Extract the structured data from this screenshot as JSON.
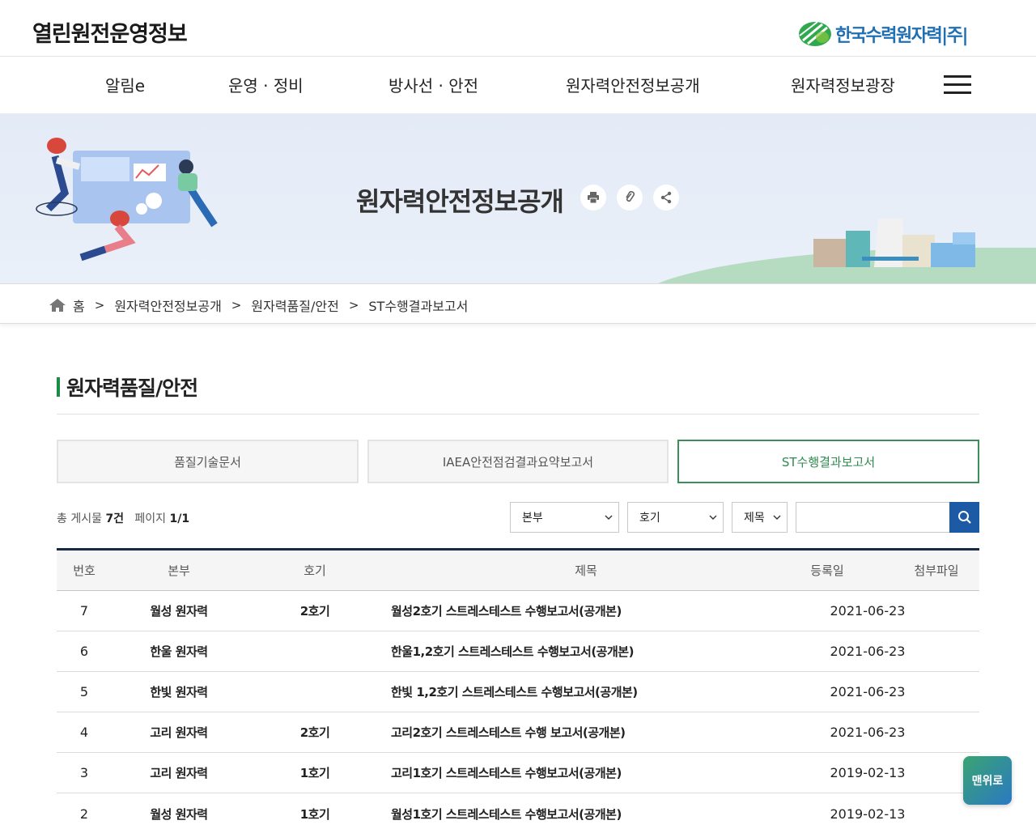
{
  "header": {
    "site_title": "열린원전운영정보",
    "brand_name": "한국수력원자력|주|"
  },
  "nav": {
    "items": [
      {
        "label": "알림e"
      },
      {
        "label": "운영 · 정비"
      },
      {
        "label": "방사선 · 안전"
      },
      {
        "label": "원자력안전정보공개"
      },
      {
        "label": "원자력정보광장"
      }
    ],
    "menu_icon": "hamburger-icon"
  },
  "banner": {
    "title": "원자력안전정보공개",
    "tools": [
      "print-icon",
      "link-icon",
      "share-icon"
    ]
  },
  "breadcrumb": {
    "home": "홈",
    "items": [
      "원자력안전정보공개",
      "원자력품질/안전",
      "ST수행결과보고서"
    ],
    "separator": ">"
  },
  "section": {
    "title": "원자력품질/안전",
    "accent": "#1a8c45"
  },
  "tabs": [
    {
      "label": "품질기술문서",
      "active": false
    },
    {
      "label": "IAEA안전점검결과요약보고서",
      "active": false
    },
    {
      "label": "ST수행결과보고서",
      "active": true
    }
  ],
  "list_info": {
    "total_label": "총 게시물",
    "total_count": "7건",
    "page_label": "페이지",
    "page_value": "1/1"
  },
  "search": {
    "hq_select": "본부",
    "unit_select": "호기",
    "field_select": "제목",
    "query": "",
    "button_icon": "search-icon",
    "button_color": "#1d5aa6"
  },
  "table": {
    "headers": {
      "no": "번호",
      "hq": "본부",
      "unit": "호기",
      "title": "제목",
      "date": "등록일",
      "file": "첨부파일"
    },
    "rows": [
      {
        "no": "7",
        "hq": "월성 원자력",
        "unit": "2호기",
        "title": "월성2호기 스트레스테스트 수행보고서(공개본)",
        "date": "2021-06-23"
      },
      {
        "no": "6",
        "hq": "한울 원자력",
        "unit": "",
        "title": "한울1,2호기 스트레스테스트 수행보고서(공개본)",
        "date": "2021-06-23"
      },
      {
        "no": "5",
        "hq": "한빛 원자력",
        "unit": "",
        "title": "한빛 1,2호기 스트레스테스트 수행보고서(공개본)",
        "date": "2021-06-23"
      },
      {
        "no": "4",
        "hq": "고리 원자력",
        "unit": "2호기",
        "title": "고리2호기 스트레스테스트 수행 보고서(공개본)",
        "date": "2021-06-23"
      },
      {
        "no": "3",
        "hq": "고리 원자력",
        "unit": "1호기",
        "title": "고리1호기 스트레스테스트 수행보고서(공개본)",
        "date": "2019-02-13"
      },
      {
        "no": "2",
        "hq": "월성 원자력",
        "unit": "1호기",
        "title": "월성1호기 스트레스테스트 수행보고서(공개본)",
        "date": "2019-02-13"
      }
    ]
  },
  "back_to_top": "맨위로"
}
